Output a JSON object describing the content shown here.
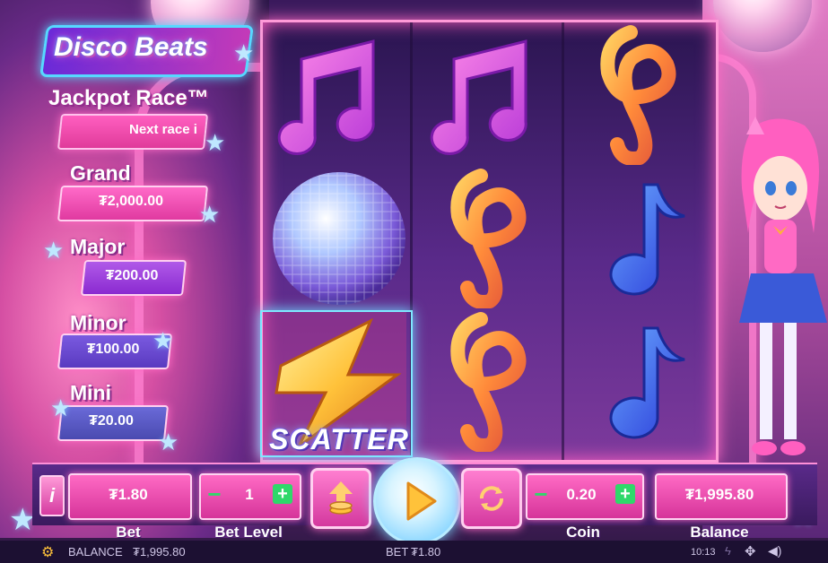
{
  "game": {
    "logo": "Disco Beats",
    "scatter_label": "SCATTER"
  },
  "jackpot": {
    "title": "Jackpot Race™",
    "race_text": "Next race i",
    "tiers": [
      {
        "label": "Grand",
        "value": "₮2,000.00",
        "color": "#ff3fa8"
      },
      {
        "label": "Major",
        "value": "₮200.00",
        "color": "#9a3ad8"
      },
      {
        "label": "Minor",
        "value": "₮100.00",
        "color": "#5a3ac8"
      },
      {
        "label": "Mini",
        "value": "₮20.00",
        "color": "#4a4ab8"
      }
    ]
  },
  "reels": [
    [
      "purple-music-note",
      "disco-ball",
      "scatter-lightning"
    ],
    [
      "purple-music-note",
      "orange-treble-clef",
      "orange-treble-clef"
    ],
    [
      "orange-treble-clef",
      "blue-music-note",
      "blue-music-note"
    ]
  ],
  "controls": {
    "info_label": "i",
    "bet": {
      "label": "Bet",
      "value": "₮1.80"
    },
    "bet_level": {
      "label": "Bet Level",
      "value": "1"
    },
    "coin": {
      "label": "Coin",
      "value": "0.20"
    },
    "balance": {
      "label": "Balance",
      "value": "₮1,995.80"
    }
  },
  "status_bar": {
    "balance_label": "BALANCE",
    "balance_value": "₮1,995.80",
    "bet_label": "BET",
    "bet_value": "₮1.80",
    "time": "10:13"
  }
}
